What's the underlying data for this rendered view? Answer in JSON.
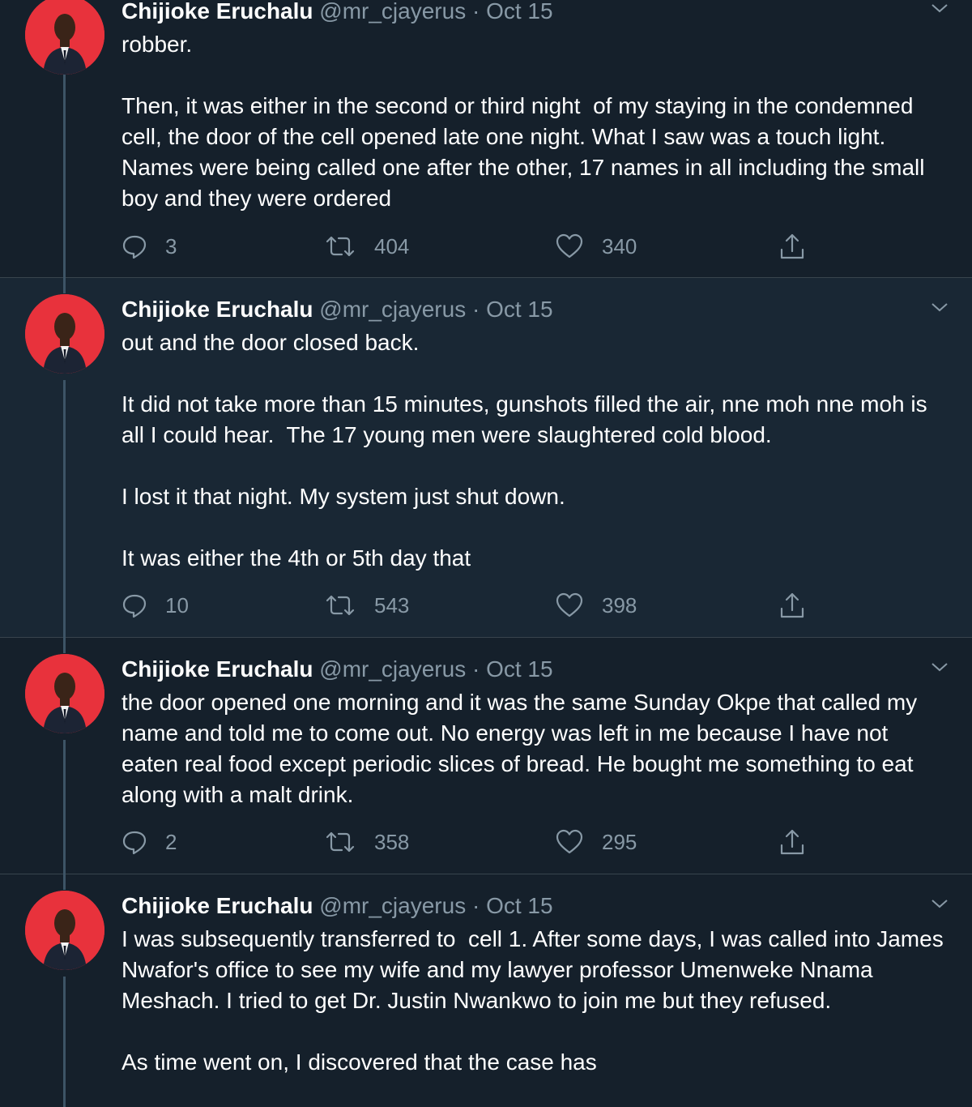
{
  "colors": {
    "background": "#15202b",
    "border": "#38444d",
    "muted": "#8899a6",
    "avatar_bg": "#e8323c",
    "thread_line": "#3d5466"
  },
  "tweets": [
    {
      "name": "Chijioke Eruchalu",
      "handle": "@mr_cjayerus",
      "dot": "·",
      "date": "Oct 15",
      "text": "robber.\n\nThen, it was either in the second or third night  of my staying in the condemned cell, the door of the cell opened late one night. What I saw was a touch light. Names were being called one after the other, 17 names in all including the small boy and they were ordered",
      "replies": "3",
      "retweets": "404",
      "likes": "340"
    },
    {
      "name": "Chijioke Eruchalu",
      "handle": "@mr_cjayerus",
      "dot": "·",
      "date": "Oct 15",
      "text": "out and the door closed back.\n\nIt did not take more than 15 minutes, gunshots filled the air, nne moh nne moh is all I could hear.  The 17 young men were slaughtered cold blood.\n\nI lost it that night. My system just shut down.\n\nIt was either the 4th or 5th day that",
      "replies": "10",
      "retweets": "543",
      "likes": "398"
    },
    {
      "name": "Chijioke Eruchalu",
      "handle": "@mr_cjayerus",
      "dot": "·",
      "date": "Oct 15",
      "text": "the door opened one morning and it was the same Sunday Okpe that called my name and told me to come out. No energy was left in me because I have not eaten real food except periodic slices of bread. He bought me something to eat along with a malt drink.",
      "replies": "2",
      "retweets": "358",
      "likes": "295"
    },
    {
      "name": "Chijioke Eruchalu",
      "handle": "@mr_cjayerus",
      "dot": "·",
      "date": "Oct 15",
      "text": "I was subsequently transferred to  cell 1. After some days, I was called into James Nwafor's office to see my wife and my lawyer professor Umenweke Nnama Meshach. I tried to get Dr. Justin Nwankwo to join me but they refused.\n\nAs time went on, I discovered that the case has"
    }
  ]
}
